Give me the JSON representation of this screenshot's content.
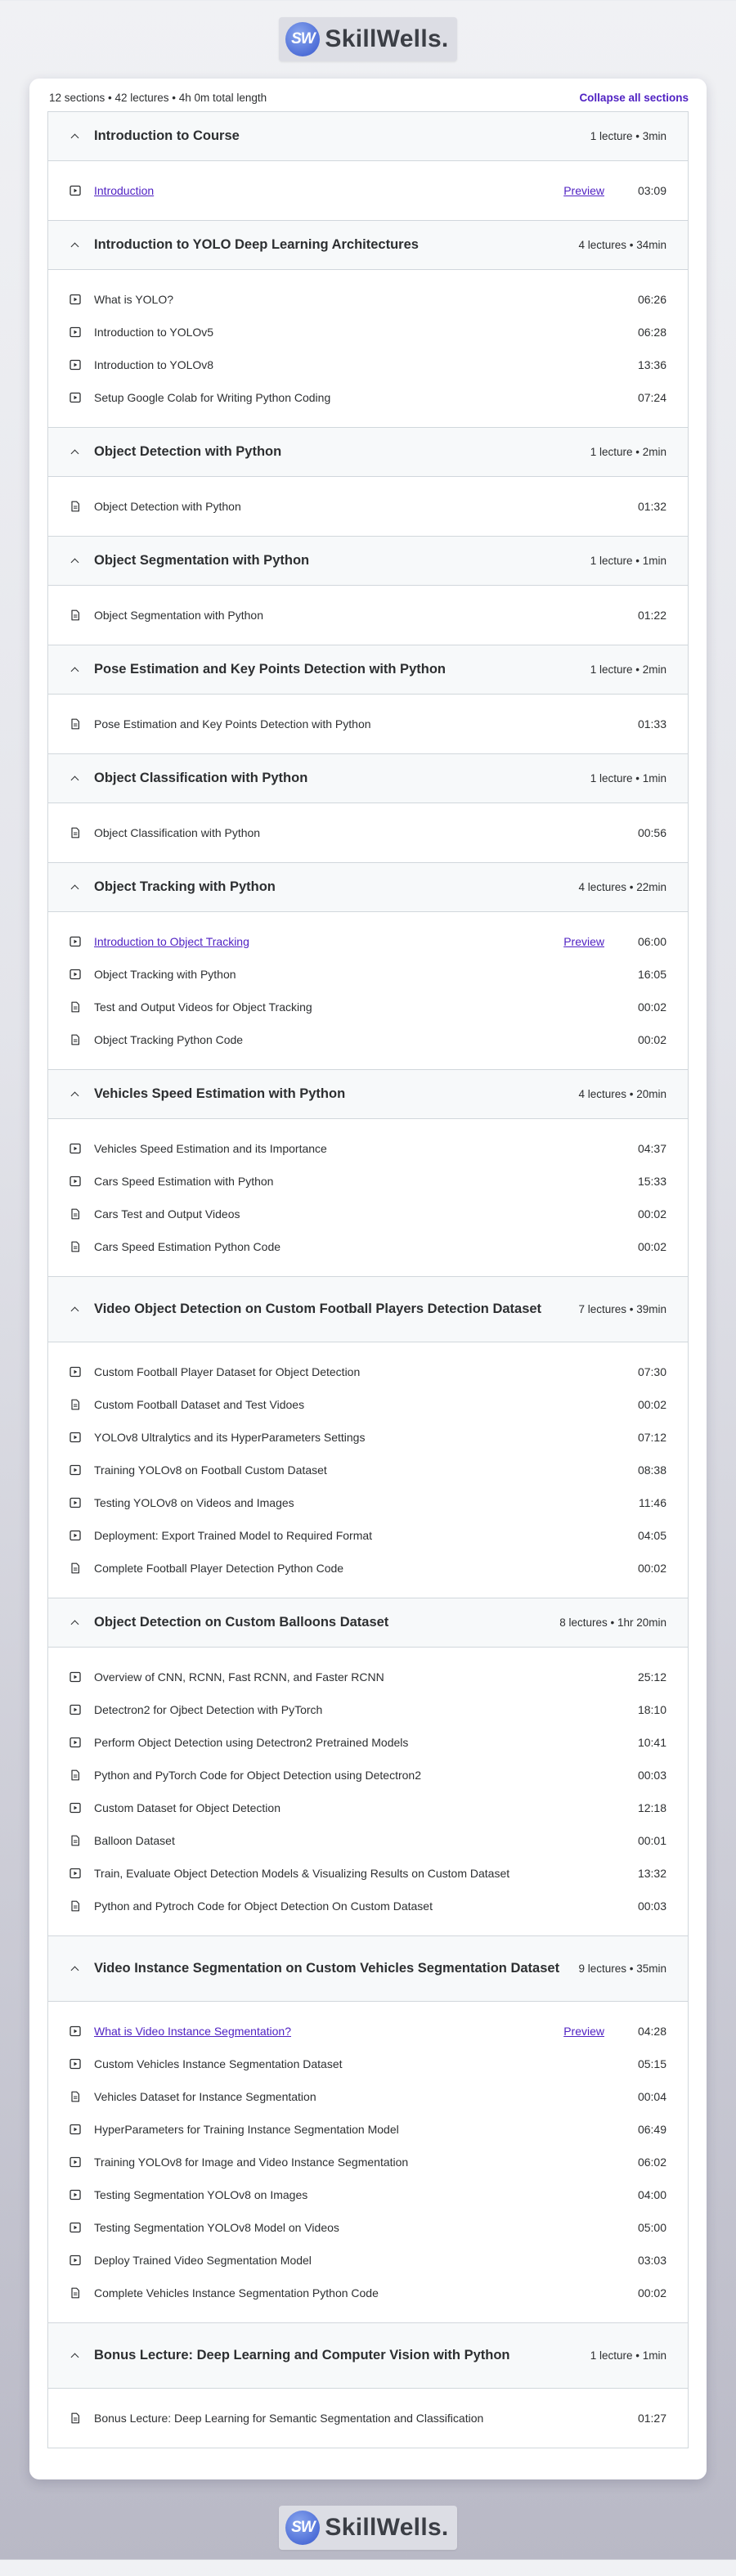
{
  "brand": {
    "name": "SkillWells.",
    "mark": "SW"
  },
  "summary": {
    "text": "12 sections • 42 lectures • 4h 0m total length",
    "collapse_label": "Collapse all sections"
  },
  "sections": [
    {
      "title": "Introduction to Course",
      "meta": "1 lecture • 3min",
      "lectures": [
        {
          "title": "Introduction",
          "type": "video",
          "duration": "03:09",
          "preview": "Preview"
        }
      ]
    },
    {
      "title": "Introduction to YOLO Deep Learning Architectures",
      "meta": "4 lectures • 34min",
      "lectures": [
        {
          "title": "What is YOLO?",
          "type": "video",
          "duration": "06:26"
        },
        {
          "title": "Introduction to YOLOv5",
          "type": "video",
          "duration": "06:28"
        },
        {
          "title": "Introduction to YOLOv8",
          "type": "video",
          "duration": "13:36"
        },
        {
          "title": "Setup Google Colab for Writing Python Coding",
          "type": "video",
          "duration": "07:24"
        }
      ]
    },
    {
      "title": "Object Detection with Python",
      "meta": "1 lecture • 2min",
      "lectures": [
        {
          "title": "Object Detection with Python",
          "type": "file",
          "duration": "01:32"
        }
      ]
    },
    {
      "title": "Object Segmentation with Python",
      "meta": "1 lecture • 1min",
      "lectures": [
        {
          "title": "Object Segmentation with Python",
          "type": "file",
          "duration": "01:22"
        }
      ]
    },
    {
      "title": "Pose Estimation and Key Points Detection with Python",
      "meta": "1 lecture • 2min",
      "lectures": [
        {
          "title": "Pose Estimation and Key Points Detection with Python",
          "type": "file",
          "duration": "01:33"
        }
      ]
    },
    {
      "title": "Object Classification with Python",
      "meta": "1 lecture • 1min",
      "lectures": [
        {
          "title": "Object Classification with Python",
          "type": "file",
          "duration": "00:56"
        }
      ]
    },
    {
      "title": "Object Tracking with Python",
      "meta": "4 lectures • 22min",
      "lectures": [
        {
          "title": "Introduction to Object Tracking",
          "type": "video",
          "duration": "06:00",
          "preview": "Preview"
        },
        {
          "title": "Object Tracking with Python",
          "type": "video",
          "duration": "16:05"
        },
        {
          "title": "Test and Output Videos for Object Tracking",
          "type": "file",
          "duration": "00:02"
        },
        {
          "title": "Object Tracking Python Code",
          "type": "file",
          "duration": "00:02"
        }
      ]
    },
    {
      "title": "Vehicles Speed Estimation with Python",
      "meta": "4 lectures • 20min",
      "lectures": [
        {
          "title": "Vehicles Speed Estimation and its Importance",
          "type": "video",
          "duration": "04:37"
        },
        {
          "title": "Cars Speed Estimation with Python",
          "type": "video",
          "duration": "15:33"
        },
        {
          "title": "Cars Test and Output Videos",
          "type": "file",
          "duration": "00:02"
        },
        {
          "title": "Cars Speed Estimation Python Code",
          "type": "file",
          "duration": "00:02"
        }
      ]
    },
    {
      "title": "Video Object Detection on Custom Football Players Detection Dataset",
      "meta": "7 lectures • 39min",
      "lectures": [
        {
          "title": "Custom Football Player Dataset for Object Detection",
          "type": "video",
          "duration": "07:30"
        },
        {
          "title": "Custom Football Dataset and Test Vidoes",
          "type": "file",
          "duration": "00:02"
        },
        {
          "title": "YOLOv8 Ultralytics and its HyperParameters Settings",
          "type": "video",
          "duration": "07:12"
        },
        {
          "title": "Training YOLOv8 on Football Custom Dataset",
          "type": "video",
          "duration": "08:38"
        },
        {
          "title": "Testing YOLOv8 on Videos and Images",
          "type": "video",
          "duration": "11:46"
        },
        {
          "title": "Deployment: Export Trained Model to Required Format",
          "type": "video",
          "duration": "04:05"
        },
        {
          "title": "Complete Football Player Detection Python Code",
          "type": "file",
          "duration": "00:02"
        }
      ]
    },
    {
      "title": "Object Detection on Custom Balloons Dataset",
      "meta": "8 lectures • 1hr 20min",
      "lectures": [
        {
          "title": "Overview of CNN, RCNN, Fast RCNN, and Faster RCNN",
          "type": "video",
          "duration": "25:12"
        },
        {
          "title": "Detectron2 for Ojbect Detection with PyTorch",
          "type": "video",
          "duration": "18:10"
        },
        {
          "title": "Perform Object Detection using Detectron2 Pretrained Models",
          "type": "video",
          "duration": "10:41"
        },
        {
          "title": "Python and PyTorch Code for Object Detection using Detectron2",
          "type": "file",
          "duration": "00:03"
        },
        {
          "title": "Custom Dataset for Object Detection",
          "type": "video",
          "duration": "12:18"
        },
        {
          "title": "Balloon Dataset",
          "type": "file",
          "duration": "00:01"
        },
        {
          "title": "Train, Evaluate Object Detection Models & Visualizing Results on Custom Dataset",
          "type": "video",
          "duration": "13:32"
        },
        {
          "title": "Python and Pytroch Code for Object Detection On Custom Dataset",
          "type": "file",
          "duration": "00:03"
        }
      ]
    },
    {
      "title": "Video Instance Segmentation on Custom Vehicles Segmentation Dataset",
      "meta": "9 lectures • 35min",
      "lectures": [
        {
          "title": "What is Video Instance Segmentation?",
          "type": "video",
          "duration": "04:28",
          "preview": "Preview"
        },
        {
          "title": "Custom Vehicles Instance Segmentation Dataset",
          "type": "video",
          "duration": "05:15"
        },
        {
          "title": "Vehicles Dataset for Instance Segmentation",
          "type": "file",
          "duration": "00:04"
        },
        {
          "title": "HyperParameters for Training Instance Segmentation Model",
          "type": "video",
          "duration": "06:49"
        },
        {
          "title": "Training YOLOv8 for Image and Video Instance Segmentation",
          "type": "video",
          "duration": "06:02"
        },
        {
          "title": "Testing Segmentation YOLOv8 on Images",
          "type": "video",
          "duration": "04:00"
        },
        {
          "title": "Testing Segmentation YOLOv8 Model on Videos",
          "type": "video",
          "duration": "05:00"
        },
        {
          "title": "Deploy Trained Video Segmentation Model",
          "type": "video",
          "duration": "03:03"
        },
        {
          "title": "Complete Vehicles Instance Segmentation Python Code",
          "type": "file",
          "duration": "00:02"
        }
      ]
    },
    {
      "title": "Bonus Lecture: Deep Learning and Computer Vision with Python",
      "meta": "1 lecture • 1min",
      "lectures": [
        {
          "title": "Bonus Lecture: Deep Learning for Semantic Segmentation and Classification",
          "type": "file",
          "duration": "01:27"
        }
      ]
    }
  ]
}
